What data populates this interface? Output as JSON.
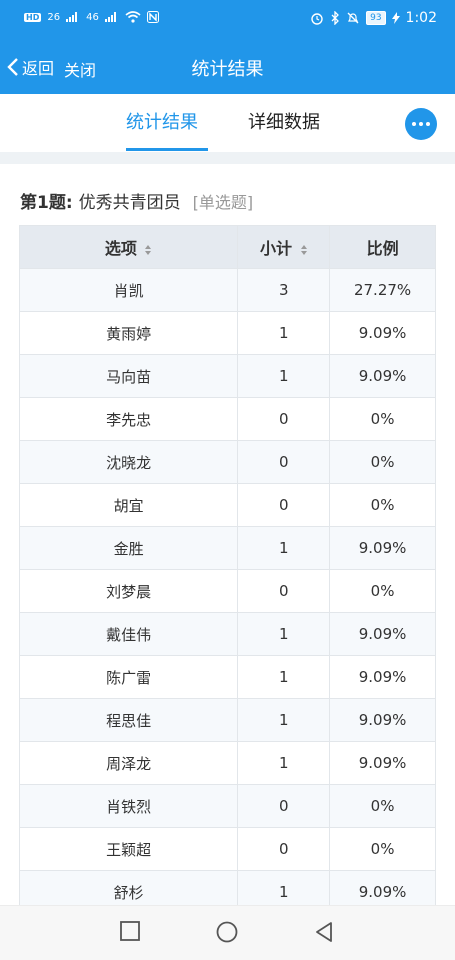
{
  "status_bar": {
    "hd_label": "HD",
    "network_1": "26",
    "network_2": "46",
    "battery": "93",
    "time": "1:02"
  },
  "nav": {
    "back_label": "返回",
    "close_label": "关闭",
    "title": "统计结果"
  },
  "tabs": [
    {
      "label": "统计结果",
      "active": true
    },
    {
      "label": "详细数据",
      "active": false
    }
  ],
  "question": {
    "number": "第1题:",
    "title": "优秀共青团员",
    "type": "[单选题]"
  },
  "table": {
    "headers": [
      "选项",
      "小计",
      "比例"
    ],
    "rows": [
      {
        "option": "肖凯",
        "count": "3",
        "percent": "27.27%"
      },
      {
        "option": "黄雨婷",
        "count": "1",
        "percent": "9.09%"
      },
      {
        "option": "马向苗",
        "count": "1",
        "percent": "9.09%"
      },
      {
        "option": "李先忠",
        "count": "0",
        "percent": "0%"
      },
      {
        "option": "沈晓龙",
        "count": "0",
        "percent": "0%"
      },
      {
        "option": "胡宜",
        "count": "0",
        "percent": "0%"
      },
      {
        "option": "金胜",
        "count": "1",
        "percent": "9.09%"
      },
      {
        "option": "刘梦晨",
        "count": "0",
        "percent": "0%"
      },
      {
        "option": "戴佳伟",
        "count": "1",
        "percent": "9.09%"
      },
      {
        "option": "陈广雷",
        "count": "1",
        "percent": "9.09%"
      },
      {
        "option": "程思佳",
        "count": "1",
        "percent": "9.09%"
      },
      {
        "option": "周泽龙",
        "count": "1",
        "percent": "9.09%"
      },
      {
        "option": "肖铁烈",
        "count": "0",
        "percent": "0%"
      },
      {
        "option": "王颖超",
        "count": "0",
        "percent": "0%"
      },
      {
        "option": "舒杉",
        "count": "1",
        "percent": "9.09%"
      }
    ]
  },
  "colors": {
    "accent": "#2196e9",
    "header_bg": "#e5eaf0"
  }
}
